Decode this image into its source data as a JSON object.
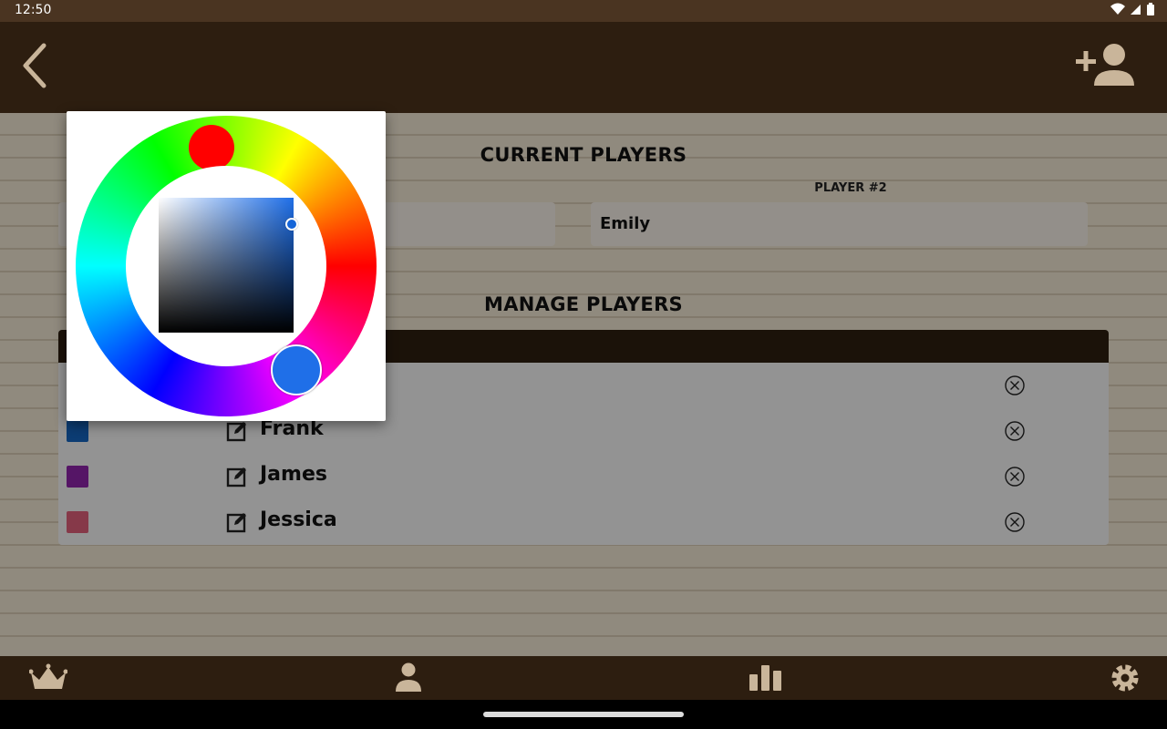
{
  "status_bar": {
    "time": "12:50"
  },
  "content": {
    "current_players_title": "CURRENT PLAYERS",
    "player2_label": "PLAYER #2",
    "player1_value": "",
    "player2_value": "Emily",
    "manage_players_title": "MANAGE PLAYERS"
  },
  "players": [
    {
      "name": "",
      "color": "#1f6fe8"
    },
    {
      "name": "Frank",
      "color": "#1565c0"
    },
    {
      "name": "James",
      "color": "#8e24aa"
    },
    {
      "name": "Jessica",
      "color": "#e0607a"
    }
  ],
  "color_picker": {
    "selected_color": "#1f6fe8"
  },
  "colors": {
    "app_bar": "#2d1e10",
    "status_bar": "#4a3421",
    "nav_icon": "#c9b59a"
  },
  "icons": {
    "back": "chevron-left-icon",
    "add_player": "person-add-icon",
    "edit": "edit-icon",
    "remove": "close-circle-icon",
    "nav": [
      "crown-icon",
      "person-icon",
      "bar-chart-icon",
      "gear-icon"
    ]
  }
}
